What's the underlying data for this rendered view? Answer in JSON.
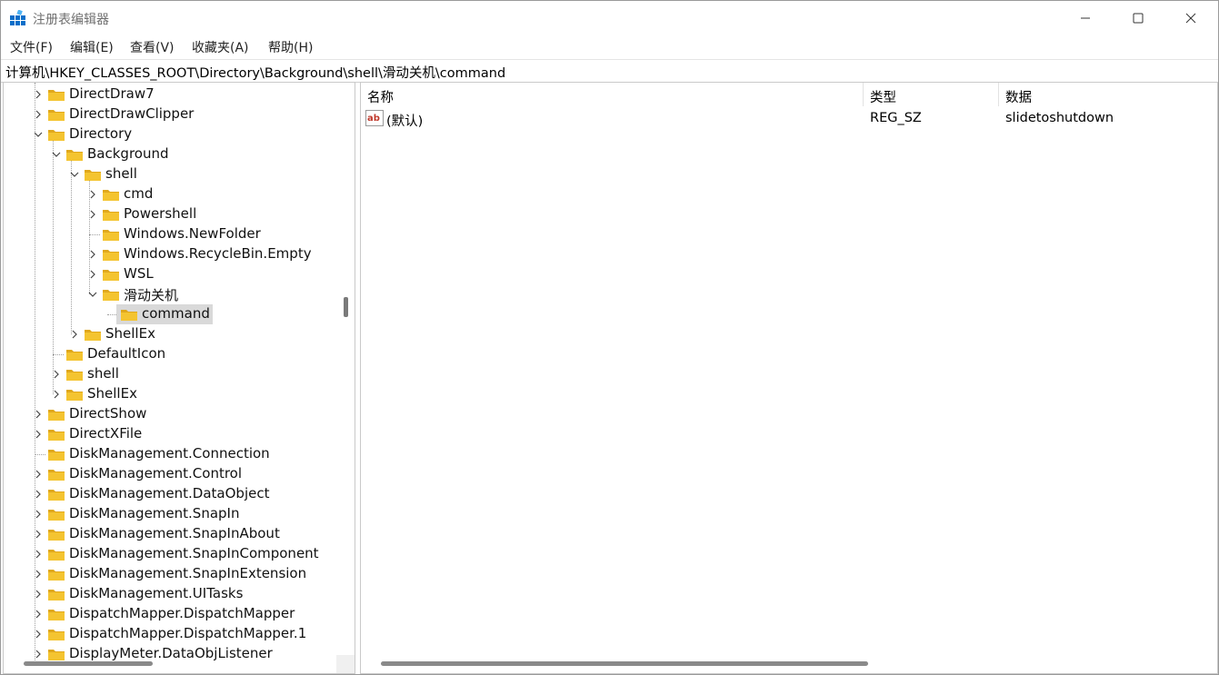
{
  "window": {
    "title": "注册表编辑器",
    "controls": [
      "minimize-icon",
      "maximize-icon",
      "close-icon"
    ]
  },
  "menu": [
    "文件(F)",
    "编辑(E)",
    "查看(V)",
    "收藏夹(A)",
    "帮助(H)"
  ],
  "address": "计算机\\HKEY_CLASSES_ROOT\\Directory\\Background\\shell\\滑动关机\\command",
  "tree": {
    "nodes": [
      {
        "label": "DirectDraw7",
        "depth": 0,
        "expander": "collapsed"
      },
      {
        "label": "DirectDrawClipper",
        "depth": 0,
        "expander": "collapsed"
      },
      {
        "label": "Directory",
        "depth": 0,
        "expander": "expanded"
      },
      {
        "label": "Background",
        "depth": 1,
        "expander": "expanded"
      },
      {
        "label": "shell",
        "depth": 2,
        "expander": "expanded"
      },
      {
        "label": "cmd",
        "depth": 3,
        "expander": "collapsed"
      },
      {
        "label": "Powershell",
        "depth": 3,
        "expander": "collapsed"
      },
      {
        "label": "Windows.NewFolder",
        "depth": 3,
        "expander": "none"
      },
      {
        "label": "Windows.RecycleBin.Empty",
        "depth": 3,
        "expander": "collapsed"
      },
      {
        "label": "WSL",
        "depth": 3,
        "expander": "collapsed"
      },
      {
        "label": "滑动关机",
        "depth": 3,
        "expander": "expanded"
      },
      {
        "label": "command",
        "depth": 4,
        "expander": "none",
        "selected": true
      },
      {
        "label": "ShellEx",
        "depth": 2,
        "expander": "collapsed"
      },
      {
        "label": "DefaultIcon",
        "depth": 1,
        "expander": "none"
      },
      {
        "label": "shell",
        "depth": 1,
        "expander": "collapsed"
      },
      {
        "label": "ShellEx",
        "depth": 1,
        "expander": "collapsed"
      },
      {
        "label": "DirectShow",
        "depth": 0,
        "expander": "collapsed"
      },
      {
        "label": "DirectXFile",
        "depth": 0,
        "expander": "collapsed"
      },
      {
        "label": "DiskManagement.Connection",
        "depth": 0,
        "expander": "none"
      },
      {
        "label": "DiskManagement.Control",
        "depth": 0,
        "expander": "collapsed"
      },
      {
        "label": "DiskManagement.DataObject",
        "depth": 0,
        "expander": "collapsed"
      },
      {
        "label": "DiskManagement.SnapIn",
        "depth": 0,
        "expander": "collapsed"
      },
      {
        "label": "DiskManagement.SnapInAbout",
        "depth": 0,
        "expander": "collapsed"
      },
      {
        "label": "DiskManagement.SnapInComponent",
        "depth": 0,
        "expander": "collapsed"
      },
      {
        "label": "DiskManagement.SnapInExtension",
        "depth": 0,
        "expander": "collapsed"
      },
      {
        "label": "DiskManagement.UITasks",
        "depth": 0,
        "expander": "collapsed"
      },
      {
        "label": "DispatchMapper.DispatchMapper",
        "depth": 0,
        "expander": "collapsed"
      },
      {
        "label": "DispatchMapper.DispatchMapper.1",
        "depth": 0,
        "expander": "collapsed"
      },
      {
        "label": "DisplayMeter.DataObjListener",
        "depth": 0,
        "expander": "collapsed"
      }
    ]
  },
  "values": {
    "columns": [
      "名称",
      "类型",
      "数据"
    ],
    "rows": [
      {
        "name": "(默认)",
        "type": "REG_SZ",
        "data": "slidetoshutdown",
        "icon": "string-value-ab-icon"
      }
    ]
  },
  "colors": {
    "folder": "#f4c430",
    "selection": "#d9d9d9",
    "icon_blue": "#0a6ec9",
    "ab_red": "#c0392b"
  }
}
